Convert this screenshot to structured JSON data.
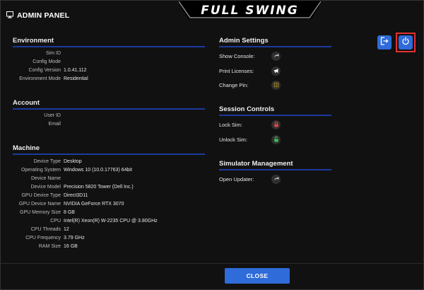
{
  "header": {
    "title": "ADMIN PANEL",
    "logo_text": "FULL SWING"
  },
  "environment": {
    "title": "Environment",
    "rows": [
      {
        "label": "Sim ID",
        "value": ""
      },
      {
        "label": "Config Mode",
        "value": ""
      },
      {
        "label": "Config Version",
        "value": "1.0.41.112"
      },
      {
        "label": "Environment Mode",
        "value": "Residential"
      }
    ]
  },
  "account": {
    "title": "Account",
    "rows": [
      {
        "label": "User ID",
        "value": ""
      },
      {
        "label": "Email",
        "value": ""
      }
    ]
  },
  "machine": {
    "title": "Machine",
    "rows": [
      {
        "label": "Device Type",
        "value": "Desktop"
      },
      {
        "label": "Operating System",
        "value": "Windows 10  (10.0.17763) 64bit"
      },
      {
        "label": "Device Name",
        "value": ""
      },
      {
        "label": "Device Model",
        "value": "Precision 5820 Tower (Dell Inc.)"
      },
      {
        "label": "GPU Device Type",
        "value": "Direct3D11"
      },
      {
        "label": "GPU Device Name",
        "value": "NVIDIA GeForce RTX 3070"
      },
      {
        "label": "GPU Memory Size",
        "value": "8 GB"
      },
      {
        "label": "CPU",
        "value": "Intel(R) Xeon(R) W-2235 CPU @ 3.80GHz"
      },
      {
        "label": "CPU Threads",
        "value": "12"
      },
      {
        "label": "CPU Frequency",
        "value": "3.79 GHz"
      },
      {
        "label": "RAM Size",
        "value": "16 GB"
      }
    ]
  },
  "admin_settings": {
    "title": "Admin Settings",
    "items": [
      {
        "label": "Show Console:",
        "icon": "arrow-right-icon"
      },
      {
        "label": "Print Licenses:",
        "icon": "megaphone-icon"
      },
      {
        "label": "Change Pin:",
        "icon": "keypad-icon"
      }
    ]
  },
  "session_controls": {
    "title": "Session Controls",
    "items": [
      {
        "label": "Lock Sim:",
        "icon": "lock-icon"
      },
      {
        "label": "Unlock Sim:",
        "icon": "unlock-icon"
      }
    ]
  },
  "simulator_management": {
    "title": "Simulator Management",
    "items": [
      {
        "label": "Open Updater:",
        "icon": "arrow-right-icon"
      }
    ]
  },
  "toolbar": {
    "exit_icon": "sign-out-icon",
    "power_icon": "power-icon"
  },
  "footer": {
    "close_label": "CLOSE"
  },
  "colors": {
    "accent": "#2f6bd9",
    "rule": "#1c3a9c",
    "highlight": "#e53030",
    "lock": "#e04848",
    "unlock": "#3cc25a",
    "keypad": "#e0b020"
  }
}
